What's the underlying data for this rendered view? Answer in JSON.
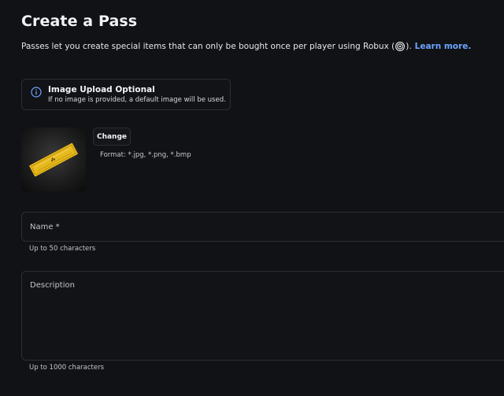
{
  "page": {
    "title": "Create a Pass",
    "subtitle_text": "Passes let you create special items that can only be bought once per player using Robux (",
    "subtitle_after_icon": ").",
    "learn_more": "Learn more.",
    "icons": [
      "robux-icon",
      "info-icon",
      "pass-ticket-image"
    ]
  },
  "notice": {
    "title": "Image Upload Optional",
    "text": "If no image is provided, a default image will be used."
  },
  "image_upload": {
    "change_label": "Change",
    "format_text": "Format: *.jpg, *.png, *.bmp"
  },
  "name_field": {
    "placeholder": "Name *",
    "hint": "Up to 50 characters"
  },
  "description_field": {
    "placeholder": "Description",
    "hint": "Up to 1000 characters"
  },
  "colors": {
    "background": "#111216",
    "link": "#6aa6ff",
    "border": "#2c2e33",
    "ticket": "#e6b91e"
  }
}
